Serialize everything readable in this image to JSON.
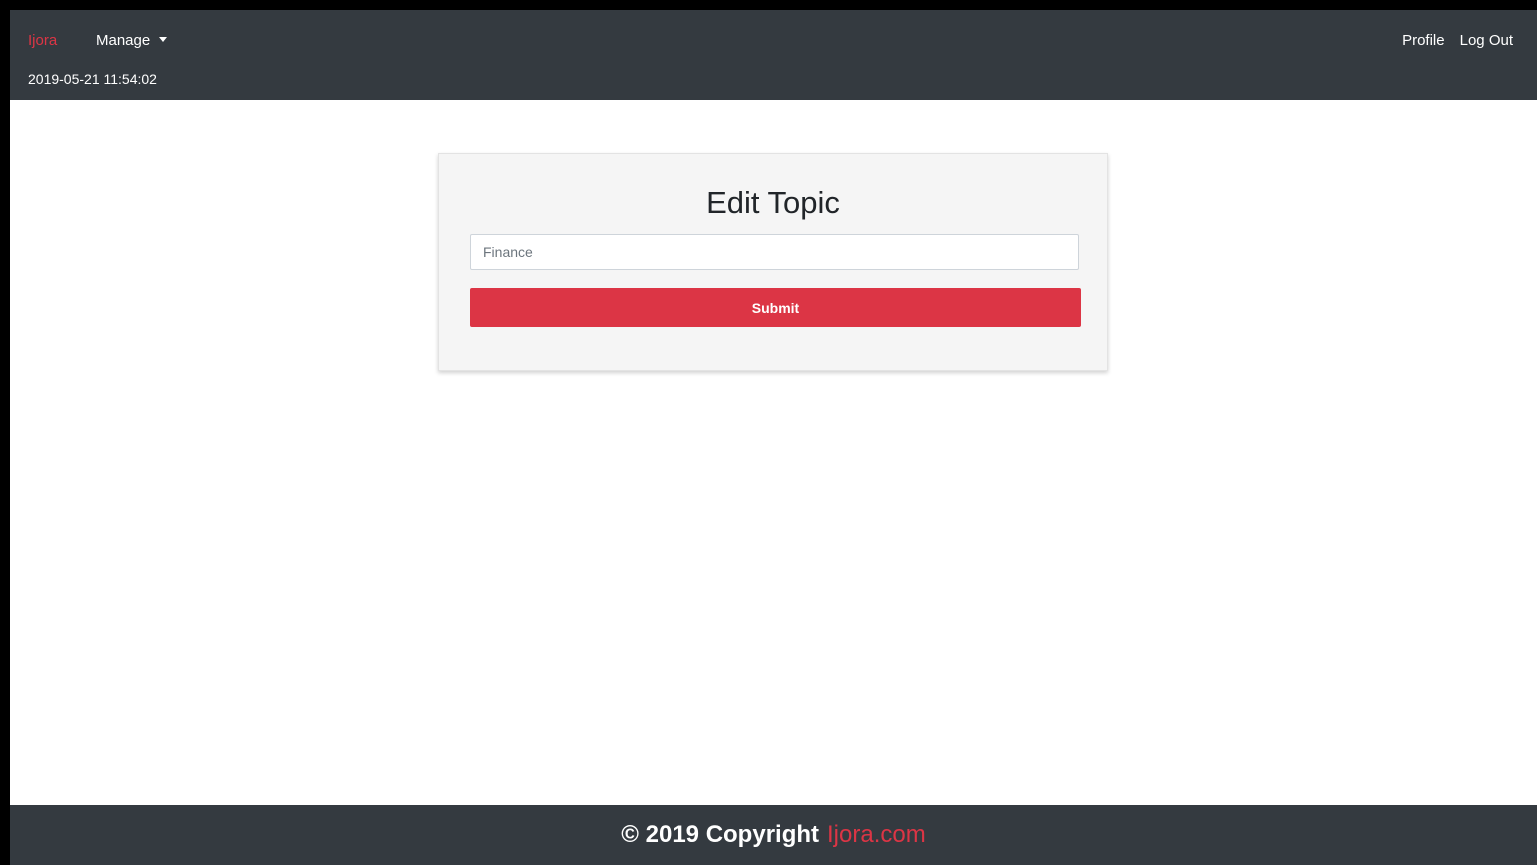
{
  "navbar": {
    "brand": "Ijora",
    "manage_label": "Manage",
    "datetime": "2019-05-21 11:54:02",
    "profile_label": "Profile",
    "logout_label": "Log Out"
  },
  "form": {
    "title": "Edit Topic",
    "topic_value": "Finance",
    "submit_label": "Submit"
  },
  "footer": {
    "copyright": "© 2019 Copyright",
    "site": "Ijora.com"
  },
  "colors": {
    "accent": "#dc3545",
    "navbar": "#343a40",
    "card_bg": "#f5f5f5"
  },
  "icons": {
    "manage_dropdown": "caret-down-icon"
  }
}
